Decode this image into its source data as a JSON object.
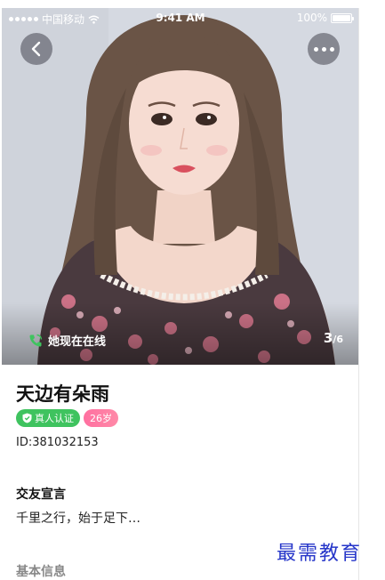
{
  "status_bar": {
    "carrier": "中国移动",
    "time": "9:41 AM",
    "battery": "100%"
  },
  "photo": {
    "online_status": "她现在在线",
    "current_index": "3",
    "total": "6"
  },
  "profile": {
    "name": "天边有朵雨",
    "verified_label": "真人认证",
    "age_label": "26岁",
    "id_text": "ID:381032153"
  },
  "declaration": {
    "title": "交友宣言",
    "text": "千里之行，始于足下…"
  },
  "basic_info": {
    "title": "基本信息"
  },
  "watermark": "最需教育",
  "colors": {
    "verified": "#3fc35f",
    "age": "#ff7aa3",
    "online_icon": "#3fc35f"
  }
}
